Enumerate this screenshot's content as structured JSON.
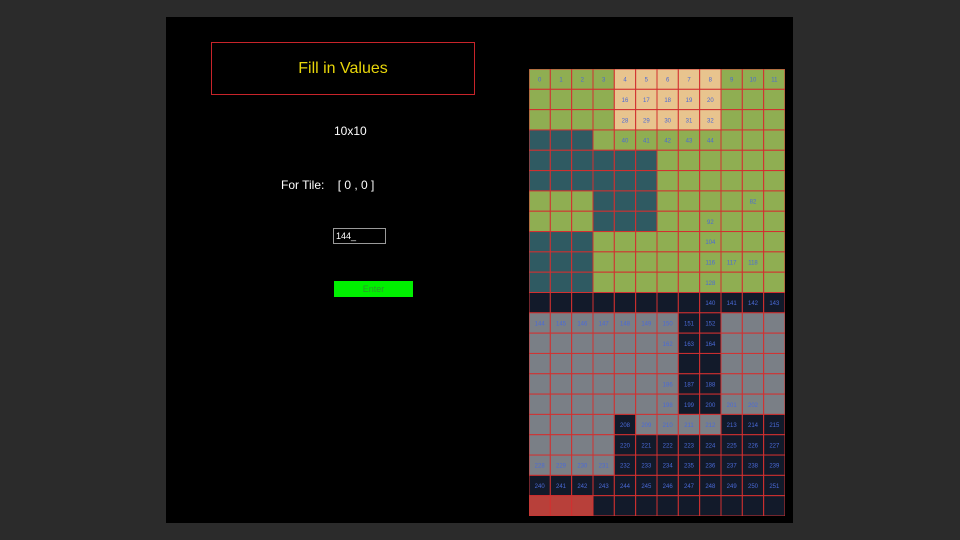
{
  "window": {
    "title": "Fill in Values",
    "grid_size_label": "10x10",
    "tile_label": "For Tile:",
    "tile_coord": "[ 0 , 0 ]",
    "input_value": "144_",
    "enter_label": "Enter"
  },
  "tileset": {
    "grid_color": "#d23030",
    "number_color": "#4a6ad8",
    "grass_color": "#8fae52",
    "sand_color": "#e8c48e",
    "water_color": "#2f5a62",
    "dark_color": "#121a2a",
    "stone_color": "#7a7f86",
    "roof_color": "#b8403a",
    "visible_numbers": [
      "0",
      "1",
      "2",
      "3",
      "4",
      "5",
      "6",
      "7",
      "8",
      "9",
      "10",
      "11",
      "16",
      "17",
      "18",
      "19",
      "20",
      "28",
      "29",
      "30",
      "31",
      "32",
      "40",
      "41",
      "42",
      "43",
      "44",
      "82",
      "92",
      "104",
      "116",
      "117",
      "118",
      "128",
      "140",
      "141",
      "142",
      "143",
      "144",
      "145",
      "146",
      "147",
      "148",
      "149",
      "150",
      "151",
      "152",
      "162",
      "163",
      "164",
      "186",
      "187",
      "188",
      "198",
      "199",
      "200",
      "201",
      "202",
      "208",
      "209",
      "210",
      "211",
      "212",
      "213",
      "214",
      "215",
      "220",
      "221",
      "222",
      "223",
      "224",
      "225",
      "226",
      "227",
      "228",
      "229",
      "230",
      "231",
      "232",
      "233",
      "234",
      "235",
      "236",
      "237",
      "238",
      "239",
      "240",
      "241",
      "242",
      "243",
      "244",
      "245",
      "246",
      "247",
      "248",
      "249",
      "250",
      "251"
    ]
  }
}
